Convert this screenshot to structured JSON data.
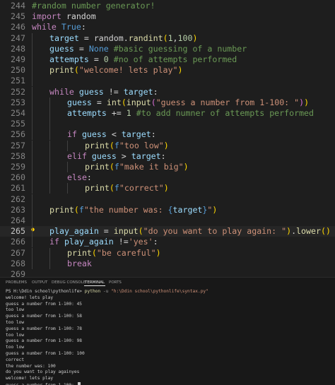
{
  "editor": {
    "lines": [
      {
        "num": "244",
        "tokens": [
          {
            "t": "#random number generator!",
            "c": "com"
          }
        ]
      },
      {
        "num": "245",
        "tokens": [
          {
            "t": "import",
            "c": "kw"
          },
          {
            "t": " random",
            "c": "op"
          }
        ]
      },
      {
        "num": "246",
        "tokens": [
          {
            "t": "while",
            "c": "kw"
          },
          {
            "t": " ",
            "c": "op"
          },
          {
            "t": "True",
            "c": "bl"
          },
          {
            "t": ":",
            "c": "op"
          }
        ]
      },
      {
        "num": "247",
        "indent": 1,
        "tokens": [
          {
            "t": "target",
            "c": "var"
          },
          {
            "t": " = random.",
            "c": "op"
          },
          {
            "t": "randint",
            "c": "fn"
          },
          {
            "t": "(",
            "c": "br1"
          },
          {
            "t": "1",
            "c": "num"
          },
          {
            "t": ",",
            "c": "op"
          },
          {
            "t": "100",
            "c": "num"
          },
          {
            "t": ")",
            "c": "br1"
          }
        ]
      },
      {
        "num": "248",
        "indent": 1,
        "tokens": [
          {
            "t": "guess",
            "c": "var"
          },
          {
            "t": " = ",
            "c": "op"
          },
          {
            "t": "None",
            "c": "bl"
          },
          {
            "t": " ",
            "c": "op"
          },
          {
            "t": "#basic guessing of a number",
            "c": "com"
          }
        ]
      },
      {
        "num": "249",
        "indent": 1,
        "tokens": [
          {
            "t": "attempts",
            "c": "var"
          },
          {
            "t": " = ",
            "c": "op"
          },
          {
            "t": "0",
            "c": "num"
          },
          {
            "t": " ",
            "c": "op"
          },
          {
            "t": "#no of attempts performed",
            "c": "com"
          }
        ]
      },
      {
        "num": "250",
        "indent": 1,
        "tokens": [
          {
            "t": "print",
            "c": "fn"
          },
          {
            "t": "(",
            "c": "br1"
          },
          {
            "t": "\"welcome! lets play\"",
            "c": "str"
          },
          {
            "t": ")",
            "c": "br1"
          }
        ]
      },
      {
        "num": "251",
        "indent": 1,
        "tokens": []
      },
      {
        "num": "252",
        "indent": 1,
        "tokens": [
          {
            "t": "while",
            "c": "kw"
          },
          {
            "t": " ",
            "c": "op"
          },
          {
            "t": "guess",
            "c": "var"
          },
          {
            "t": " != ",
            "c": "op"
          },
          {
            "t": "target",
            "c": "var"
          },
          {
            "t": ":",
            "c": "op"
          }
        ]
      },
      {
        "num": "253",
        "indent": 2,
        "tokens": [
          {
            "t": "guess",
            "c": "var"
          },
          {
            "t": " = ",
            "c": "op"
          },
          {
            "t": "int",
            "c": "fn"
          },
          {
            "t": "(",
            "c": "br1"
          },
          {
            "t": "input",
            "c": "fn"
          },
          {
            "t": "(",
            "c": "br2"
          },
          {
            "t": "\"guess a number from 1-100: \"",
            "c": "str"
          },
          {
            "t": ")",
            "c": "br2"
          },
          {
            "t": ")",
            "c": "br1"
          }
        ]
      },
      {
        "num": "254",
        "indent": 2,
        "tokens": [
          {
            "t": "attempts",
            "c": "var"
          },
          {
            "t": " += ",
            "c": "op"
          },
          {
            "t": "1",
            "c": "num"
          },
          {
            "t": " ",
            "c": "op"
          },
          {
            "t": "#to add numner of attempts performed",
            "c": "com"
          }
        ]
      },
      {
        "num": "255",
        "indent": 2,
        "tokens": []
      },
      {
        "num": "256",
        "indent": 2,
        "tokens": [
          {
            "t": "if",
            "c": "kw"
          },
          {
            "t": " ",
            "c": "op"
          },
          {
            "t": "guess",
            "c": "var"
          },
          {
            "t": " < ",
            "c": "op"
          },
          {
            "t": "target",
            "c": "var"
          },
          {
            "t": ":",
            "c": "op"
          }
        ]
      },
      {
        "num": "257",
        "indent": 3,
        "tokens": [
          {
            "t": "print",
            "c": "fn"
          },
          {
            "t": "(",
            "c": "br1"
          },
          {
            "t": "f",
            "c": "bl"
          },
          {
            "t": "\"too low\"",
            "c": "str"
          },
          {
            "t": ")",
            "c": "br1"
          }
        ]
      },
      {
        "num": "258",
        "indent": 2,
        "tokens": [
          {
            "t": "elif",
            "c": "kw"
          },
          {
            "t": " ",
            "c": "op"
          },
          {
            "t": "guess",
            "c": "var"
          },
          {
            "t": " > ",
            "c": "op"
          },
          {
            "t": "target",
            "c": "var"
          },
          {
            "t": ":",
            "c": "op"
          }
        ]
      },
      {
        "num": "259",
        "indent": 3,
        "tokens": [
          {
            "t": "print",
            "c": "fn"
          },
          {
            "t": "(",
            "c": "br1"
          },
          {
            "t": "f",
            "c": "bl"
          },
          {
            "t": "\"make it big\"",
            "c": "str"
          },
          {
            "t": ")",
            "c": "br1"
          }
        ]
      },
      {
        "num": "260",
        "indent": 2,
        "tokens": [
          {
            "t": "else",
            "c": "kw"
          },
          {
            "t": ":",
            "c": "op"
          }
        ]
      },
      {
        "num": "261",
        "indent": 3,
        "tokens": [
          {
            "t": "print",
            "c": "fn"
          },
          {
            "t": "(",
            "c": "br1"
          },
          {
            "t": "f",
            "c": "bl"
          },
          {
            "t": "\"correct\"",
            "c": "str"
          },
          {
            "t": ")",
            "c": "br1"
          }
        ]
      },
      {
        "num": "262",
        "indent": 1,
        "tokens": []
      },
      {
        "num": "263",
        "indent": 1,
        "tokens": [
          {
            "t": "print",
            "c": "fn"
          },
          {
            "t": "(",
            "c": "br1"
          },
          {
            "t": "f",
            "c": "bl"
          },
          {
            "t": "\"the number was: ",
            "c": "str"
          },
          {
            "t": "{",
            "c": "bl"
          },
          {
            "t": "target",
            "c": "var"
          },
          {
            "t": "}",
            "c": "bl"
          },
          {
            "t": "\"",
            "c": "str"
          },
          {
            "t": ")",
            "c": "br1"
          }
        ]
      },
      {
        "num": "264",
        "indent": 1,
        "tokens": []
      },
      {
        "num": "265",
        "indent": 1,
        "current": true,
        "lightbulb": true,
        "tokens": [
          {
            "t": "play_again",
            "c": "var"
          },
          {
            "t": " = ",
            "c": "op"
          },
          {
            "t": "input",
            "c": "fn"
          },
          {
            "t": "(",
            "c": "br1"
          },
          {
            "t": "\"do you want to play again: \"",
            "c": "str"
          },
          {
            "t": ")",
            "c": "br1"
          },
          {
            "t": ".",
            "c": "op"
          },
          {
            "t": "lower",
            "c": "fn"
          },
          {
            "t": "(",
            "c": "br1"
          },
          {
            "t": ")",
            "c": "br1"
          }
        ]
      },
      {
        "num": "266",
        "indent": 1,
        "tokens": [
          {
            "t": "if",
            "c": "kw"
          },
          {
            "t": " ",
            "c": "op"
          },
          {
            "t": "play_again",
            "c": "var"
          },
          {
            "t": " !=",
            "c": "op"
          },
          {
            "t": "'yes'",
            "c": "str"
          },
          {
            "t": ":",
            "c": "op"
          }
        ]
      },
      {
        "num": "267",
        "indent": 2,
        "tokens": [
          {
            "t": "print",
            "c": "fn"
          },
          {
            "t": "(",
            "c": "br1"
          },
          {
            "t": "\"be careful\"",
            "c": "str"
          },
          {
            "t": ")",
            "c": "br1"
          }
        ]
      },
      {
        "num": "268",
        "indent": 2,
        "tokens": [
          {
            "t": "break",
            "c": "kw"
          }
        ]
      },
      {
        "num": "269",
        "tokens": []
      }
    ]
  },
  "panel": {
    "tabs": [
      {
        "label": "PROBLEMS",
        "active": false
      },
      {
        "label": "OUTPUT",
        "active": false
      },
      {
        "label": "DEBUG CONSOLE",
        "active": false
      },
      {
        "label": "TERMINAL",
        "active": true
      },
      {
        "label": "PORTS",
        "active": false
      }
    ],
    "prompt": {
      "ps": "PS H:\\Ddin school\\pythonlife> ",
      "cmd": "python",
      "flag": " -u ",
      "path": "\"h:\\Ddin school\\pythonlife\\syntax.py\""
    },
    "output": [
      "welcome! lets play",
      "guess a number from 1-100: 45",
      "too low",
      "guess a number from 1-100: 58",
      "too low",
      "guess a number from 1-100: 78",
      "too low",
      "guess a number from 1-100: 98",
      "too low",
      "guess a number from 1-100: 100",
      "correct",
      "the number was: 100",
      "do you want to play againyes",
      "welcome! lets play",
      "guess a number from 1-100: "
    ]
  },
  "icons": {
    "lightbulb": "lightbulb-icon"
  }
}
